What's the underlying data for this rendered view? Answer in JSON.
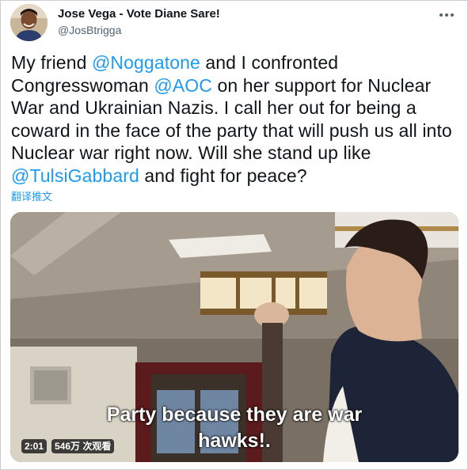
{
  "author": {
    "display_name": "Jose Vega - Vote Diane Sare!",
    "handle": "@JosBtrigga",
    "avatar_icon": "profile-avatar"
  },
  "more_icon": "more-horizontal-icon",
  "tweet": {
    "t1": "My friend ",
    "m1": "@Noggatone",
    "t2": " and I confronted Congresswoman ",
    "m2": "@AOC",
    "t3": " on her support for Nuclear War and Ukrainian Nazis. I call her out for being a coward in the face of the party that will push us all into Nuclear war right now. Will she stand up like ",
    "m3": "@TulsiGabbard",
    "t4": " and fight for peace?"
  },
  "translate_label": "翻译推文",
  "video": {
    "subtitle_line1": "Party because they are war",
    "subtitle_line2": "hawks!.",
    "duration": "2:01",
    "views": "546万 次观看"
  },
  "colors": {
    "link": "#1d9bf0",
    "text": "#0f1419",
    "secondary": "#536471"
  }
}
